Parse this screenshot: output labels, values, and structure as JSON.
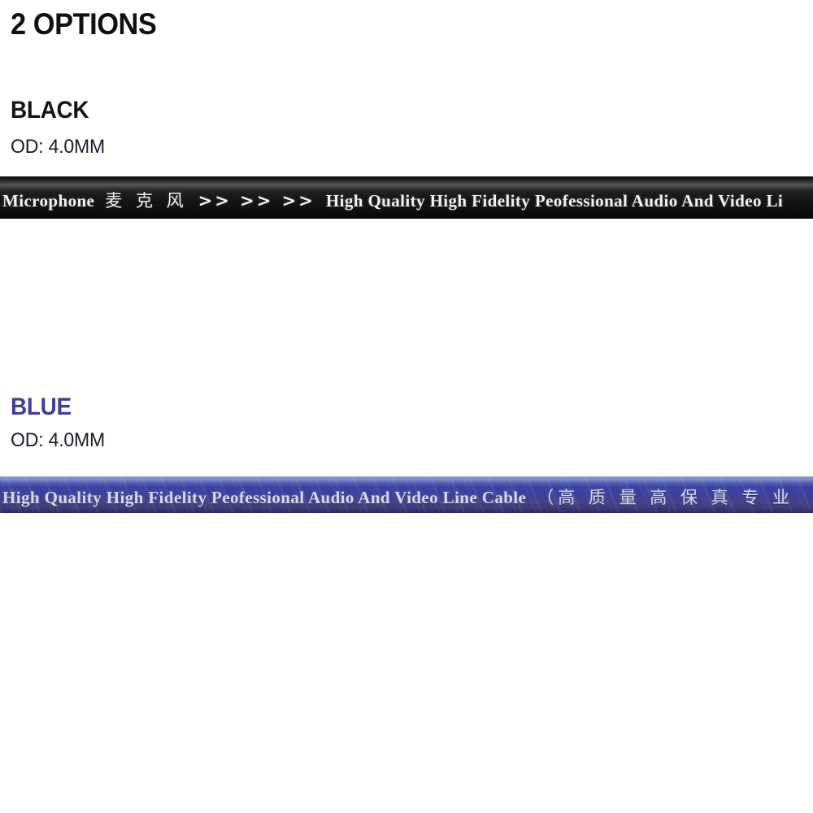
{
  "page": {
    "title": "2 OPTIONS"
  },
  "options": [
    {
      "name": "BLACK",
      "od_label": "OD: 4.0MM",
      "color_hex": "#141414",
      "cable_print": {
        "brand": "Microphone",
        "brand_cjk": "麦 克 风",
        "chevrons": ">> >> >>",
        "line": "High Quality High Fidelity Peofessional Audio And Video Li"
      }
    },
    {
      "name": "BLUE",
      "od_label": "OD: 4.0MM",
      "color_hex": "#3b3f9e",
      "cable_print": {
        "line": "High Quality High Fidelity Peofessional Audio And Video Line Cable",
        "line_cjk": "（高 质 量 高 保 真 专 业"
      }
    }
  ]
}
